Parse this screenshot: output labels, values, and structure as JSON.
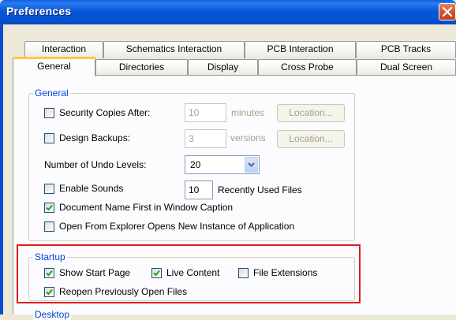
{
  "window": {
    "title": "Preferences"
  },
  "tabs_back": [
    "Interaction",
    "Schematics Interaction",
    "PCB Interaction",
    "PCB Tracks"
  ],
  "tabs_front": [
    "General",
    "Directories",
    "Display",
    "Cross Probe",
    "Dual Screen"
  ],
  "general": {
    "title": "General",
    "security": {
      "label": "Security Copies After:",
      "value": "10",
      "unit": "minutes",
      "button": "Location...",
      "checked": false
    },
    "backups": {
      "label": "Design Backups:",
      "value": "3",
      "unit": "versions",
      "button": "Location...",
      "checked": false
    },
    "undo": {
      "label": "Number of Undo Levels:",
      "value": "20"
    },
    "sounds": {
      "label": "Enable Sounds",
      "checked": false
    },
    "recent": {
      "value": "10",
      "label": "Recently Used Files"
    },
    "docname": {
      "label": "Document Name First in Window Caption",
      "checked": true
    },
    "explorer": {
      "label": "Open From Explorer Opens New Instance of Application",
      "checked": false
    }
  },
  "startup": {
    "title": "Startup",
    "show_start_page": {
      "label": "Show Start Page",
      "checked": true
    },
    "live_content": {
      "label": "Live Content",
      "checked": true
    },
    "file_extensions": {
      "label": "File Extensions",
      "checked": false
    },
    "reopen": {
      "label": "Reopen Previously Open Files",
      "checked": true
    }
  },
  "next_group": {
    "title": "Desktop"
  },
  "colors": {
    "accent": "#0046d5",
    "highlight": "#e01c1c",
    "tab_active": "#ffc83c"
  }
}
